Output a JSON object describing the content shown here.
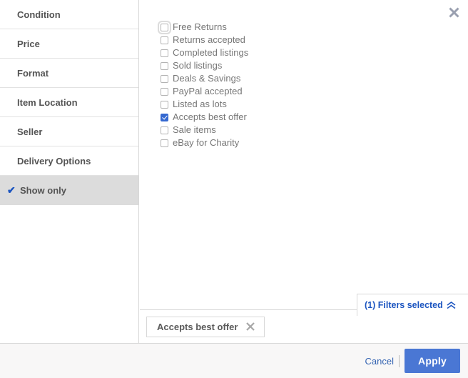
{
  "dialog": {
    "close_icon": "close-icon"
  },
  "sidebar": {
    "items": [
      {
        "label": "Condition",
        "selected": false
      },
      {
        "label": "Price",
        "selected": false
      },
      {
        "label": "Format",
        "selected": false
      },
      {
        "label": "Item Location",
        "selected": false
      },
      {
        "label": "Seller",
        "selected": false
      },
      {
        "label": "Delivery Options",
        "selected": false
      },
      {
        "label": "Show only",
        "selected": true,
        "check_glyph": "✔"
      }
    ]
  },
  "show_only": {
    "options": [
      {
        "label": "Free Returns",
        "checked": false,
        "focused": true
      },
      {
        "label": "Returns accepted",
        "checked": false,
        "focused": false
      },
      {
        "label": "Completed listings",
        "checked": false,
        "focused": false
      },
      {
        "label": "Sold listings",
        "checked": false,
        "focused": false
      },
      {
        "label": "Deals & Savings",
        "checked": false,
        "focused": false
      },
      {
        "label": "PayPal accepted",
        "checked": false,
        "focused": false
      },
      {
        "label": "Listed as lots",
        "checked": false,
        "focused": false
      },
      {
        "label": "Accepts best offer",
        "checked": true,
        "focused": false
      },
      {
        "label": "Sale items",
        "checked": false,
        "focused": false
      },
      {
        "label": "eBay for Charity",
        "checked": false,
        "focused": false
      }
    ]
  },
  "filters_tab": {
    "label": "(1) Filters selected",
    "count": 1,
    "chevron_icon": "double-chevron-up-icon"
  },
  "chips": [
    {
      "label": "Accepts best offer",
      "remove_icon": "close-icon"
    }
  ],
  "footer": {
    "cancel_label": "Cancel",
    "apply_label": "Apply"
  },
  "colors": {
    "accent_blue": "#1c55c0",
    "apply_button": "#4a77d4",
    "checkbox_checked": "#3468d0",
    "selected_row_bg": "#dcdcdc",
    "footer_bg": "#f8f7f7",
    "border": "#d8d8d8",
    "label_text": "#767676"
  }
}
